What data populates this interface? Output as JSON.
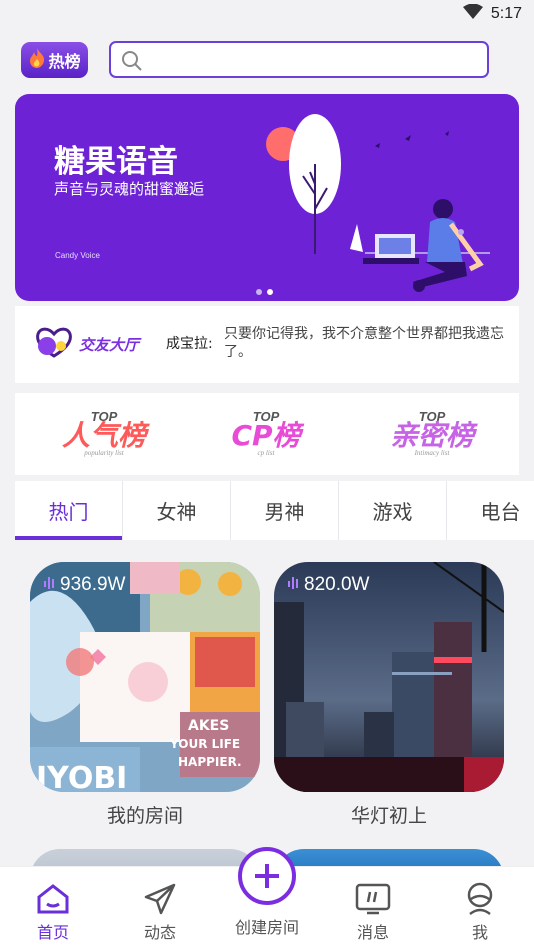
{
  "status": {
    "time": "5:17"
  },
  "header": {
    "hot_label": "热榜",
    "search_placeholder": ""
  },
  "banner": {
    "title": "糖果语音",
    "subtitle": "声音与灵魂的甜蜜邂逅",
    "tiny": "Candy Voice",
    "accent": "#6d22d6",
    "page_count": 2,
    "active_page": 2
  },
  "hall": {
    "logo_text": "交友大厅",
    "speaker": "成宝拉:",
    "message": "只要你记得我，我不介意整个世界都把我遗忘了。"
  },
  "ranks": [
    {
      "top": "TOP",
      "title": "人气榜",
      "sub": "popularity list"
    },
    {
      "top": "TOP",
      "title": "CP榜",
      "sub": "cp list"
    },
    {
      "top": "TOP",
      "title": "亲密榜",
      "sub": "Intimacy list"
    }
  ],
  "tabs": [
    "热门",
    "女神",
    "男神",
    "游戏",
    "电台"
  ],
  "rooms": [
    {
      "hot": "936.9W",
      "name": "我的房间"
    },
    {
      "hot": "820.0W",
      "name": "华灯初上"
    }
  ],
  "nav": {
    "home": "首页",
    "feed": "动态",
    "create": "创建房间",
    "messages": "消息",
    "me": "我"
  },
  "colors": {
    "primary": "#6a2fd8",
    "background": "#f2f2f5"
  }
}
